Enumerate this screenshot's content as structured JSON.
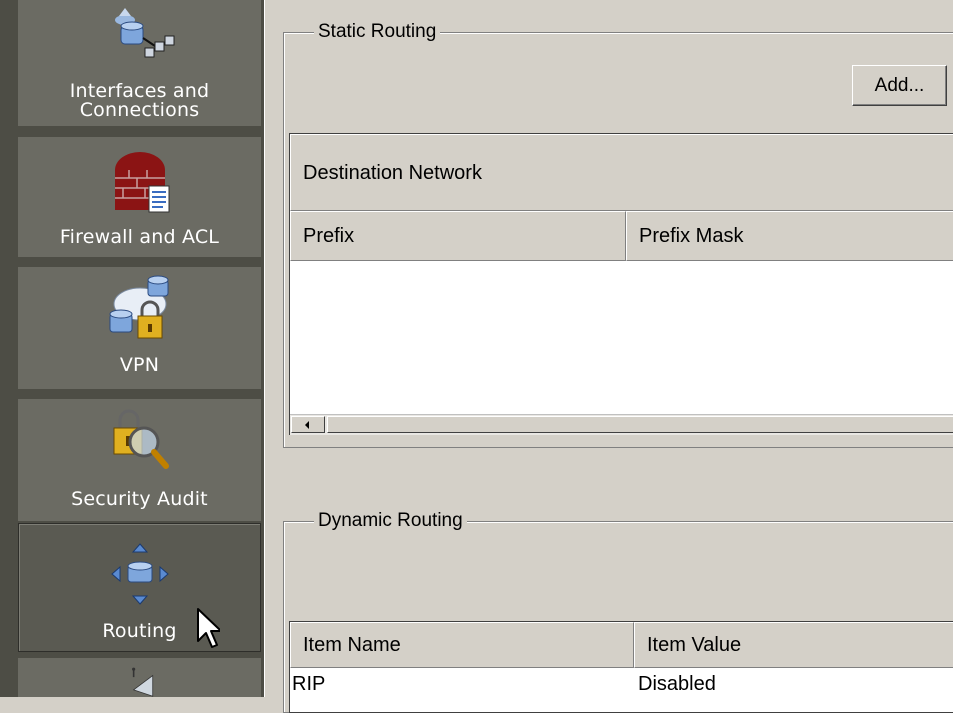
{
  "sidebar": {
    "items": [
      {
        "label": "Interfaces and\nConnections",
        "icon": "network-interfaces-icon"
      },
      {
        "label": "Firewall and ACL",
        "icon": "firewall-icon"
      },
      {
        "label": "VPN",
        "icon": "vpn-lock-icon"
      },
      {
        "label": "Security Audit",
        "icon": "security-audit-icon"
      },
      {
        "label": "Routing",
        "icon": "routing-icon",
        "active": true
      },
      {
        "label": "",
        "icon": "satellite-icon"
      }
    ]
  },
  "static_routing": {
    "title": "Static Routing",
    "add_label": "Add...",
    "group_header": "Destination Network",
    "columns": [
      "Prefix",
      "Prefix Mask"
    ]
  },
  "dynamic_routing": {
    "title": "Dynamic Routing",
    "columns": [
      "Item Name",
      "Item Value"
    ],
    "rows": [
      {
        "name": "RIP",
        "value": "Disabled"
      }
    ]
  },
  "colors": {
    "sidebar_bg": "#4d4d45",
    "nav_item_bg": "#6b6b63",
    "panel_bg": "#d4d0c8"
  }
}
